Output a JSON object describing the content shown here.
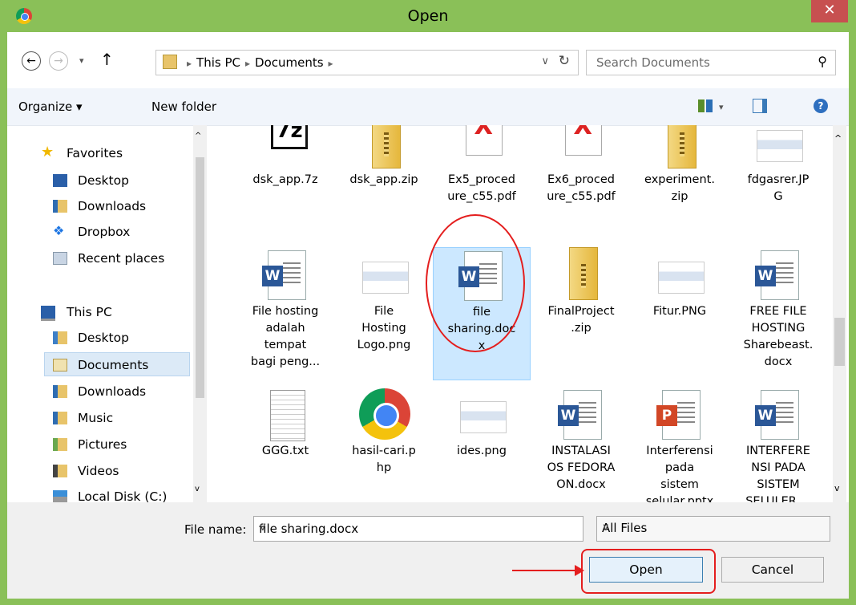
{
  "window": {
    "title": "Open",
    "close_glyph": "✕"
  },
  "nav": {
    "back_glyph": "←",
    "forward_glyph": "→",
    "recent_glyph": "▾",
    "up_glyph": "↑",
    "crumbs": [
      "This PC",
      "Documents"
    ],
    "sep": "▸",
    "dropdown_glyph": "∨",
    "refresh_glyph": "↻",
    "search_placeholder": "Search Documents",
    "search_glyph": "⚲"
  },
  "toolbar": {
    "organize": "Organize ▾",
    "new_folder": "New folder",
    "views_glyph": "▾",
    "help_glyph": "?"
  },
  "sidebar": {
    "favorites": "Favorites",
    "fav_items": [
      "Desktop",
      "Downloads",
      "Dropbox",
      "Recent places"
    ],
    "thispc": "This PC",
    "pc_items": [
      "Desktop",
      "Documents",
      "Downloads",
      "Music",
      "Pictures",
      "Videos",
      "Local Disk (C:)"
    ],
    "selected": "Documents"
  },
  "files": [
    {
      "label": "dsk_app.7z",
      "icon": "7z-icon"
    },
    {
      "label": "dsk_app.zip",
      "icon": "zip-folder-icon"
    },
    {
      "label": "Ex5_proced\nure_c55.pdf",
      "icon": "pdf-icon"
    },
    {
      "label": "Ex6_proced\nure_c55.pdf",
      "icon": "pdf-icon"
    },
    {
      "label": "experiment.\nzip",
      "icon": "zip-folder-icon"
    },
    {
      "label": "fdgasrer.JP\nG",
      "icon": "image-icon"
    },
    {
      "label": "File hosting\nadalah\ntempat\nbagi peng...",
      "icon": "word-doc-icon"
    },
    {
      "label": "File\nHosting\nLogo.png",
      "icon": "image-icon"
    },
    {
      "label": "file\nsharing.doc\nx",
      "icon": "word-doc-icon"
    },
    {
      "label": "FinalProject\n.zip",
      "icon": "zip-folder-icon"
    },
    {
      "label": "Fitur.PNG",
      "icon": "image-icon"
    },
    {
      "label": "FREE FILE\nHOSTING\nSharebeast.\ndocx",
      "icon": "word-doc-icon"
    },
    {
      "label": "GGG.txt",
      "icon": "text-file-icon"
    },
    {
      "label": "hasil-cari.p\nhp",
      "icon": "chrome-icon"
    },
    {
      "label": "ides.png",
      "icon": "image-icon"
    },
    {
      "label": "INSTALASI\nOS FEDORA\nON.docx",
      "icon": "word-doc-icon"
    },
    {
      "label": "Interferensi\npada\nsistem\nselular.pptx",
      "icon": "powerpoint-icon"
    },
    {
      "label": "INTERFERE\nNSI PADA\nSISTEM\nSELULER....",
      "icon": "word-doc-icon"
    }
  ],
  "selected_file": "file\nsharing.doc\nx",
  "bottom": {
    "filename_label": "File name:",
    "filename_value": "file sharing.docx",
    "filter_value": "All Files",
    "open_label": "Open",
    "cancel_label": "Cancel"
  },
  "colors": {
    "frame": "#8ac058",
    "close": "#c75050",
    "annotation": "#e41e1e",
    "selection": "#cce8ff"
  }
}
